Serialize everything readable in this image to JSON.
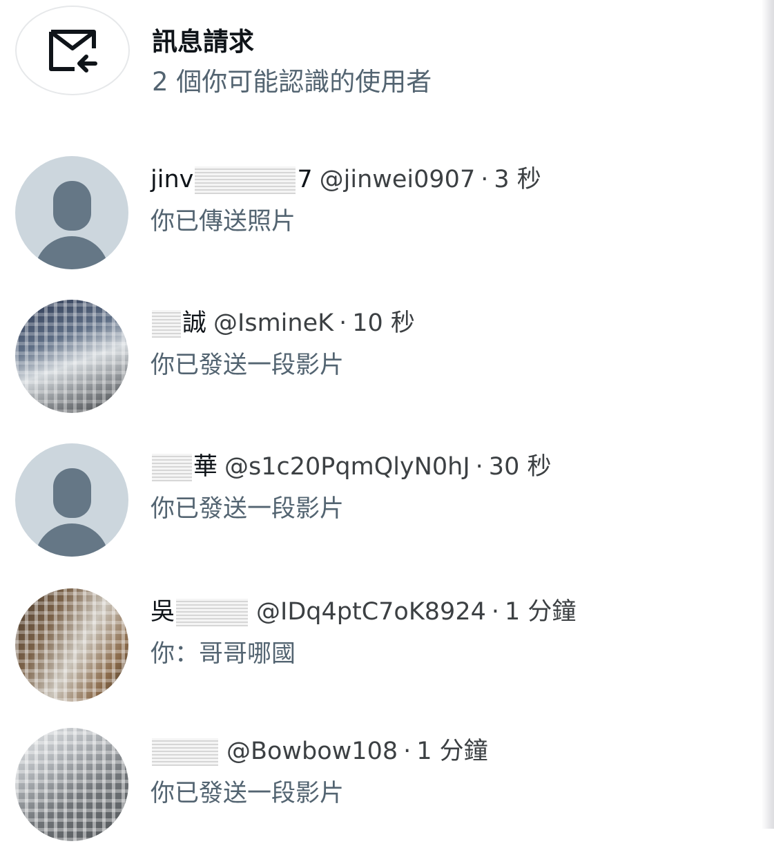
{
  "request": {
    "icon": "mail-request-icon",
    "title": "訊息請求",
    "subtitle": "2 個你可能認識的使用者"
  },
  "conversations": [
    {
      "name_prefix": "jinv",
      "name_suffix": "7",
      "handle": "@jinwei0907",
      "sep": "·",
      "time": "3 秒",
      "preview": "你已傳送照片",
      "avatar": "default"
    },
    {
      "name_prefix": "",
      "name_suffix": "誠",
      "handle": "@IsmineK",
      "sep": "·",
      "time": "10 秒",
      "preview": "你已發送一段影片",
      "avatar": "photo"
    },
    {
      "name_prefix": "",
      "name_suffix": "華",
      "handle": "@s1c20PqmQlyN0hJ",
      "sep": "·",
      "time": "30 秒",
      "preview": "你已發送一段影片",
      "avatar": "default"
    },
    {
      "name_prefix": "吳",
      "name_suffix": "",
      "handle": "@IDq4ptC7oK8924",
      "sep": "·",
      "time": "1 分鐘",
      "preview": "你：哥哥哪國",
      "avatar": "photo"
    },
    {
      "name_prefix": "",
      "name_suffix": "",
      "handle": "@Bowbow108",
      "sep": "·",
      "time": "1 分鐘",
      "preview": "你已發送一段影片",
      "avatar": "photo"
    }
  ]
}
